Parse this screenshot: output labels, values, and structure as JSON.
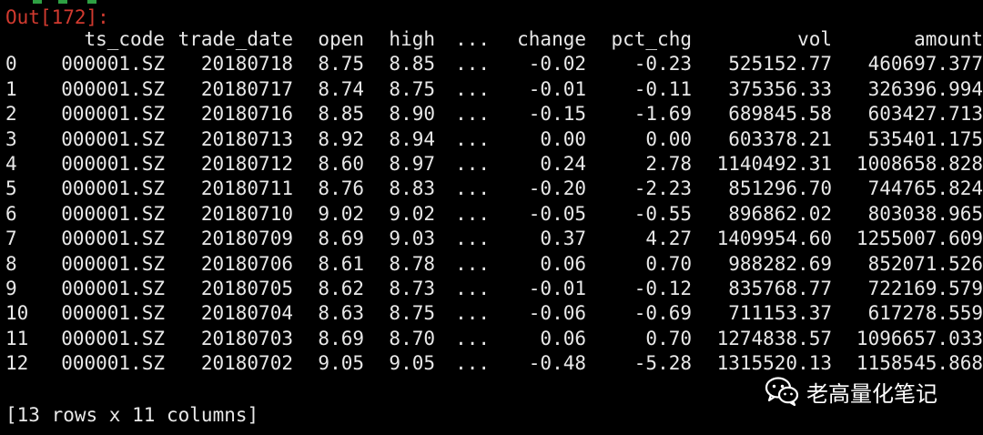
{
  "output_prompt": "Out[172]:",
  "accent_colors": {
    "prompt": "#d13a2f",
    "text": "#e8e8e8",
    "background": "#000000"
  },
  "dataframe": {
    "columns": [
      "",
      "ts_code",
      "trade_date",
      "open",
      "high",
      "...",
      "change",
      "pct_chg",
      "vol",
      "amount"
    ],
    "rows": [
      [
        "0",
        "000001.SZ",
        "20180718",
        "8.75",
        "8.85",
        "...",
        "-0.02",
        "-0.23",
        "525152.77",
        "460697.377"
      ],
      [
        "1",
        "000001.SZ",
        "20180717",
        "8.74",
        "8.75",
        "...",
        "-0.01",
        "-0.11",
        "375356.33",
        "326396.994"
      ],
      [
        "2",
        "000001.SZ",
        "20180716",
        "8.85",
        "8.90",
        "...",
        "-0.15",
        "-1.69",
        "689845.58",
        "603427.713"
      ],
      [
        "3",
        "000001.SZ",
        "20180713",
        "8.92",
        "8.94",
        "...",
        "0.00",
        "0.00",
        "603378.21",
        "535401.175"
      ],
      [
        "4",
        "000001.SZ",
        "20180712",
        "8.60",
        "8.97",
        "...",
        "0.24",
        "2.78",
        "1140492.31",
        "1008658.828"
      ],
      [
        "5",
        "000001.SZ",
        "20180711",
        "8.76",
        "8.83",
        "...",
        "-0.20",
        "-2.23",
        "851296.70",
        "744765.824"
      ],
      [
        "6",
        "000001.SZ",
        "20180710",
        "9.02",
        "9.02",
        "...",
        "-0.05",
        "-0.55",
        "896862.02",
        "803038.965"
      ],
      [
        "7",
        "000001.SZ",
        "20180709",
        "8.69",
        "9.03",
        "...",
        "0.37",
        "4.27",
        "1409954.60",
        "1255007.609"
      ],
      [
        "8",
        "000001.SZ",
        "20180706",
        "8.61",
        "8.78",
        "...",
        "0.06",
        "0.70",
        "988282.69",
        "852071.526"
      ],
      [
        "9",
        "000001.SZ",
        "20180705",
        "8.62",
        "8.73",
        "...",
        "-0.01",
        "-0.12",
        "835768.77",
        "722169.579"
      ],
      [
        "10",
        "000001.SZ",
        "20180704",
        "8.63",
        "8.75",
        "...",
        "-0.06",
        "-0.69",
        "711153.37",
        "617278.559"
      ],
      [
        "11",
        "000001.SZ",
        "20180703",
        "8.69",
        "8.70",
        "...",
        "0.06",
        "0.70",
        "1274838.57",
        "1096657.033"
      ],
      [
        "12",
        "000001.SZ",
        "20180702",
        "9.05",
        "9.05",
        "...",
        "-0.48",
        "-5.28",
        "1315520.13",
        "1158545.868"
      ]
    ]
  },
  "summary": "[13 rows x 11 columns]",
  "watermark": {
    "icon": "wechat-icon",
    "text": "老高量化笔记"
  }
}
